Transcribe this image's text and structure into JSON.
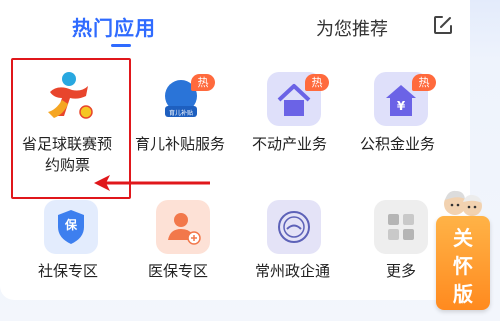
{
  "tabs": {
    "active_label": "热门应用",
    "other_label": "为您推荐",
    "edit_icon": "edit-icon"
  },
  "apps": [
    {
      "label_line1": "省足球联赛预",
      "label_line2": "约购票",
      "icon": "football-logo-icon",
      "badge": ""
    },
    {
      "label": "育儿补贴服务",
      "icon": "childcare-subsidy-icon",
      "badge": "热",
      "icon_caption": "育儿补贴"
    },
    {
      "label": "不动产业务",
      "icon": "house-icon",
      "badge": "热"
    },
    {
      "label": "公积金业务",
      "icon": "housing-fund-icon",
      "badge": "热",
      "icon_caption": "¥"
    },
    {
      "label": "社保专区",
      "icon": "social-insurance-icon",
      "badge": "",
      "icon_caption": "保"
    },
    {
      "label": "医保专区",
      "icon": "medical-insurance-icon",
      "badge": ""
    },
    {
      "label": "常州政企通",
      "icon": "changzhou-seal-icon",
      "badge": ""
    },
    {
      "label": "更多",
      "icon": "more-grid-icon",
      "badge": ""
    }
  ],
  "side_widget": {
    "chars": [
      "关",
      "怀",
      "版"
    ],
    "icon": "elderly-mascot-icon"
  },
  "colors": {
    "accent": "#2f6bff",
    "badge": "#ff6a3d",
    "highlight": "#e0171b",
    "care_mode": "#ff8a1f"
  }
}
